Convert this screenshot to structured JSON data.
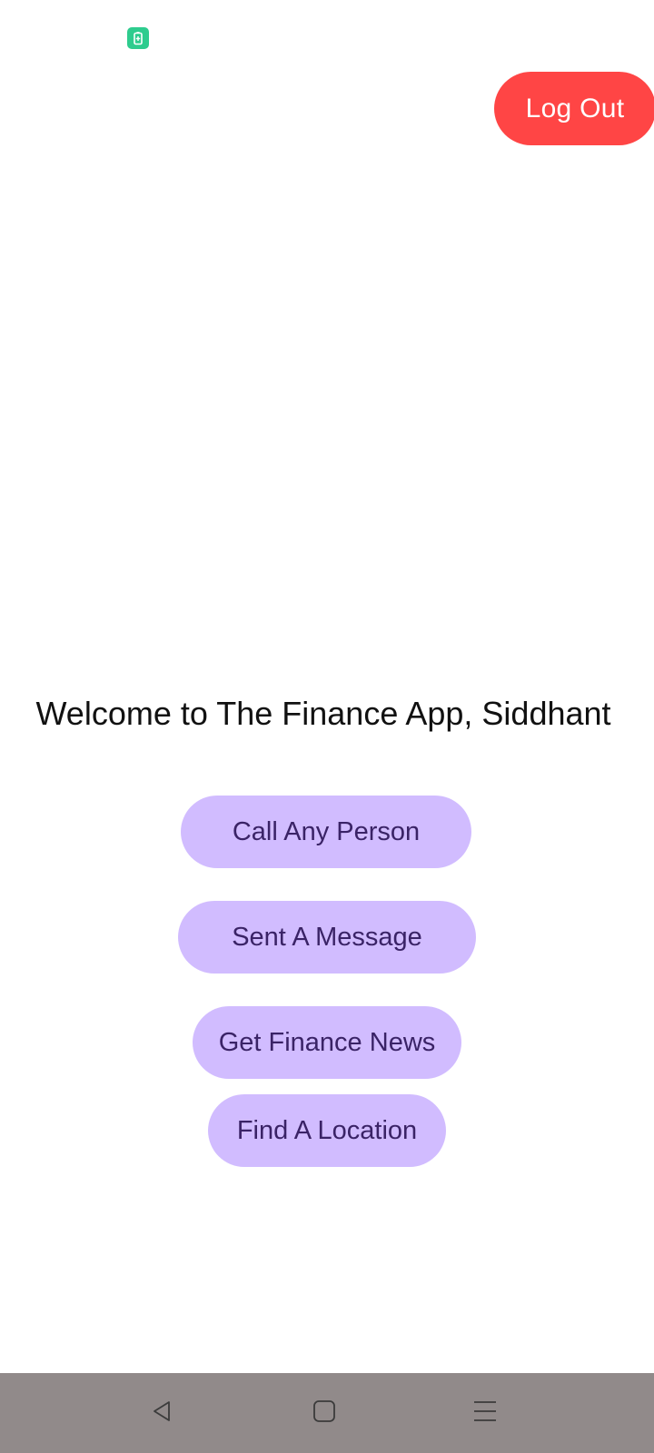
{
  "status_bar": {
    "icons": [
      "battery-saver-icon"
    ],
    "accent_color": "#2ecc8e"
  },
  "header": {
    "logout_label": "Log Out",
    "logout_color": "#ff4545"
  },
  "main": {
    "welcome_text": "Welcome to The Finance App, Siddhant",
    "actions": [
      {
        "label": "Call Any Person"
      },
      {
        "label": "Sent A Message"
      },
      {
        "label": "Get Finance News"
      },
      {
        "label": "Find A Location"
      }
    ],
    "action_color": "#d1bcff",
    "action_text_color": "#3a2366"
  },
  "nav_bar": {
    "buttons": [
      "back-icon",
      "home-icon",
      "recents-icon"
    ],
    "background": "#918a8a"
  }
}
